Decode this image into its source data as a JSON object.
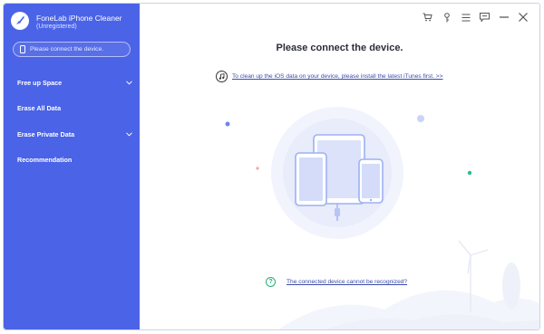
{
  "app": {
    "title": "FoneLab iPhone Cleaner",
    "subtitle": "(Unregistered)",
    "device_status": "Please connect the device."
  },
  "sidebar": {
    "items": [
      {
        "label": "Free up Space",
        "expandable": true
      },
      {
        "label": "Erase All Data",
        "expandable": false
      },
      {
        "label": "Erase Private Data",
        "expandable": true
      },
      {
        "label": "Recommendation",
        "expandable": false
      }
    ]
  },
  "window_controls": [
    "cart-icon",
    "key-icon",
    "menu-icon",
    "feedback-icon",
    "minimize-icon",
    "close-icon"
  ],
  "main": {
    "headline": "Please connect the device.",
    "itunes_link": "To clean up the iOS data on your device, please install the latest iTunes first. >>",
    "help_link": "The connected device cannot be recognized?"
  },
  "colors": {
    "sidebar": "#4a63e7",
    "accent_link": "#3a4ca8",
    "help_green": "#27b07a"
  }
}
